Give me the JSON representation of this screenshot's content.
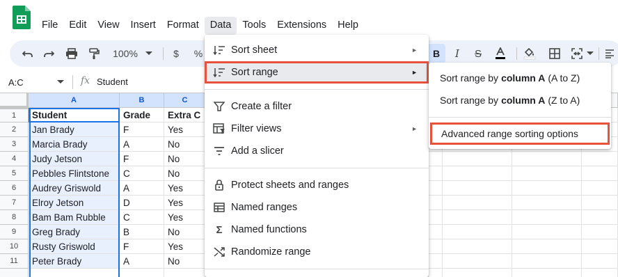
{
  "menubar": {
    "items": [
      "File",
      "Edit",
      "View",
      "Insert",
      "Format",
      "Data",
      "Tools",
      "Extensions",
      "Help"
    ],
    "active_index": 5
  },
  "toolbar": {
    "zoom": "100%",
    "currency": "$",
    "percent": "%"
  },
  "formula_bar": {
    "name_box": "A:C",
    "fx": "fx",
    "content": "Student"
  },
  "grid": {
    "columns": [
      "A",
      "B",
      "C"
    ],
    "rows": [
      [
        "Student",
        "Grade",
        "Extra C"
      ],
      [
        "Jan Brady",
        "F",
        "Yes"
      ],
      [
        "Marcia Brady",
        "A",
        "No"
      ],
      [
        "Judy Jetson",
        "F",
        "No"
      ],
      [
        "Pebbles Flintstone",
        "C",
        "No"
      ],
      [
        "Audrey Griswold",
        "A",
        "Yes"
      ],
      [
        "Elroy Jetson",
        "D",
        "Yes"
      ],
      [
        "Bam Bam Rubble",
        "C",
        "Yes"
      ],
      [
        "Greg Brady",
        "B",
        "No"
      ],
      [
        "Rusty Griswold",
        "F",
        "Yes"
      ],
      [
        "Peter Brady",
        "A",
        "No"
      ]
    ],
    "row_numbers": [
      "1",
      "2",
      "3",
      "4",
      "5",
      "6",
      "7",
      "8",
      "9",
      "10",
      "11"
    ]
  },
  "data_menu": {
    "sort_sheet": "Sort sheet",
    "sort_range": "Sort range",
    "create_filter": "Create a filter",
    "filter_views": "Filter views",
    "add_slicer": "Add a slicer",
    "protect": "Protect sheets and ranges",
    "named_ranges": "Named ranges",
    "named_functions": "Named functions",
    "randomize": "Randomize range",
    "submenu_arrow": "►"
  },
  "sort_range_submenu": {
    "a_to_z_prefix": "Sort range by",
    "a_to_z_bold": "column A",
    "a_to_z_suffix": "(A to Z)",
    "z_to_a_prefix": "Sort range by",
    "z_to_a_bold": "column A",
    "z_to_a_suffix": "(Z to A)",
    "advanced": "Advanced range sorting options"
  },
  "colors": {
    "accent": "#1a73e8",
    "highlight_box": "#e8513a",
    "column_selection": "#e8f0fe",
    "toolbar_bg": "#edf2fa",
    "logo_green": "#0f9d58"
  },
  "icons": [
    "sheets-logo-icon",
    "undo-icon",
    "redo-icon",
    "print-icon",
    "paint-format-icon",
    "bold-icon",
    "italic-icon",
    "strikethrough-icon",
    "text-color-icon",
    "fill-color-icon",
    "borders-icon",
    "merge-cells-icon",
    "align-left-icon",
    "sort-icon",
    "filter-icon",
    "filter-views-icon",
    "slicer-icon",
    "lock-icon",
    "named-ranges-icon",
    "sigma-icon",
    "shuffle-icon"
  ]
}
